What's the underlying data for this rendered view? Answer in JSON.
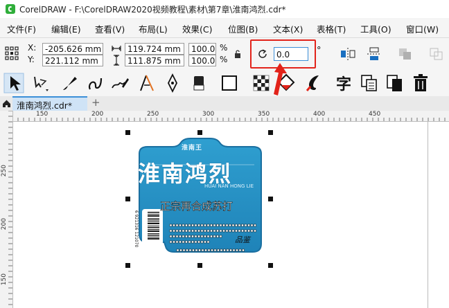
{
  "window": {
    "title": "CorelDRAW - F:\\CorelDRAW2020视频教程\\素材\\第7章\\淮南鸿烈.cdr*"
  },
  "menu": [
    {
      "label": "文件(F)",
      "name": "menu-file"
    },
    {
      "label": "编辑(E)",
      "name": "menu-edit"
    },
    {
      "label": "查看(V)",
      "name": "menu-view"
    },
    {
      "label": "布局(L)",
      "name": "menu-layout"
    },
    {
      "label": "效果(C)",
      "name": "menu-effects"
    },
    {
      "label": "位图(B)",
      "name": "menu-bitmaps"
    },
    {
      "label": "文本(X)",
      "name": "menu-text"
    },
    {
      "label": "表格(T)",
      "name": "menu-table"
    },
    {
      "label": "工具(O)",
      "name": "menu-tools"
    },
    {
      "label": "窗口(W)",
      "name": "menu-window"
    }
  ],
  "property_bar": {
    "x_label": "X:",
    "y_label": "Y:",
    "x_value": "-205.626 mm",
    "y_value": "221.112 mm",
    "width_value": "119.724 mm",
    "height_value": "111.875 mm",
    "scale_x": "100.0",
    "scale_y": "100.0",
    "percent": "%",
    "rotation_value": "0.0",
    "degree": "°"
  },
  "document": {
    "tab_label": "淮南鸿烈.cdr*",
    "add_tab": "+"
  },
  "ruler": {
    "h_ticks": [
      "150",
      "200",
      "250",
      "300",
      "350",
      "400",
      "450"
    ],
    "v_ticks": [
      "250",
      "200",
      "150"
    ]
  },
  "label_art": {
    "top_small": "淮南王",
    "main_title": "淮南鸿烈",
    "pinyin": "HUAI NAN HONG LIE",
    "subtitle": "正宗再合成苏打",
    "bottom_mark": "品鉴",
    "barcode_digits": "6 921316 121070"
  },
  "colors": {
    "label_blue": "#2f9fd0",
    "label_dark": "#1a6fa0",
    "accent_red": "#e2231a",
    "tab_blue": "#cfe3f6"
  },
  "icons": {
    "dimensions": "dimension-arrows-icon",
    "lock": "lock-icon",
    "rotate": "rotate-icon",
    "arrow_annotation": "red-arrow-icon"
  }
}
